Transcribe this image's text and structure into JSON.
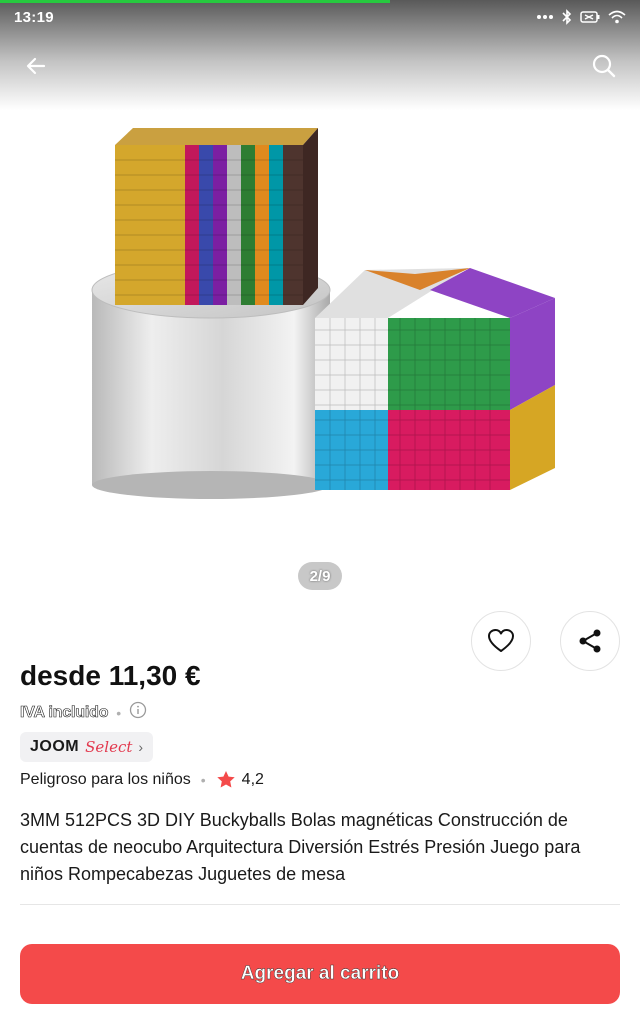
{
  "status_bar": {
    "time": "13:19",
    "icons": [
      "more-dots-icon",
      "bluetooth-icon",
      "battery-icon",
      "wifi-icon"
    ]
  },
  "header": {
    "back_icon": "arrow-left-icon",
    "search_icon": "search-icon"
  },
  "gallery": {
    "counter": "2/9",
    "current": 2,
    "total": 9
  },
  "actions": {
    "favorite_icon": "heart-icon",
    "share_icon": "share-icon"
  },
  "product": {
    "price": "desde 11,30 €",
    "vat": "IVA incluido",
    "badge": {
      "brand": "JOOM",
      "label": "Select"
    },
    "warning": "Peligroso para los niños",
    "rating": "4,2",
    "title": "3MM 512PCS 3D DIY Buckyballs Bolas magnéticas Construcción de cuentas de neocubo Arquitectura Diversión Estrés Presión Juego para niños Rompecabezas Juguetes de mesa"
  },
  "cart_button": "Agregar al carrito",
  "colors": {
    "accent": "#f44a4a",
    "star": "#f44a4a",
    "select": "#e2384d",
    "progress": "#27c93f"
  }
}
